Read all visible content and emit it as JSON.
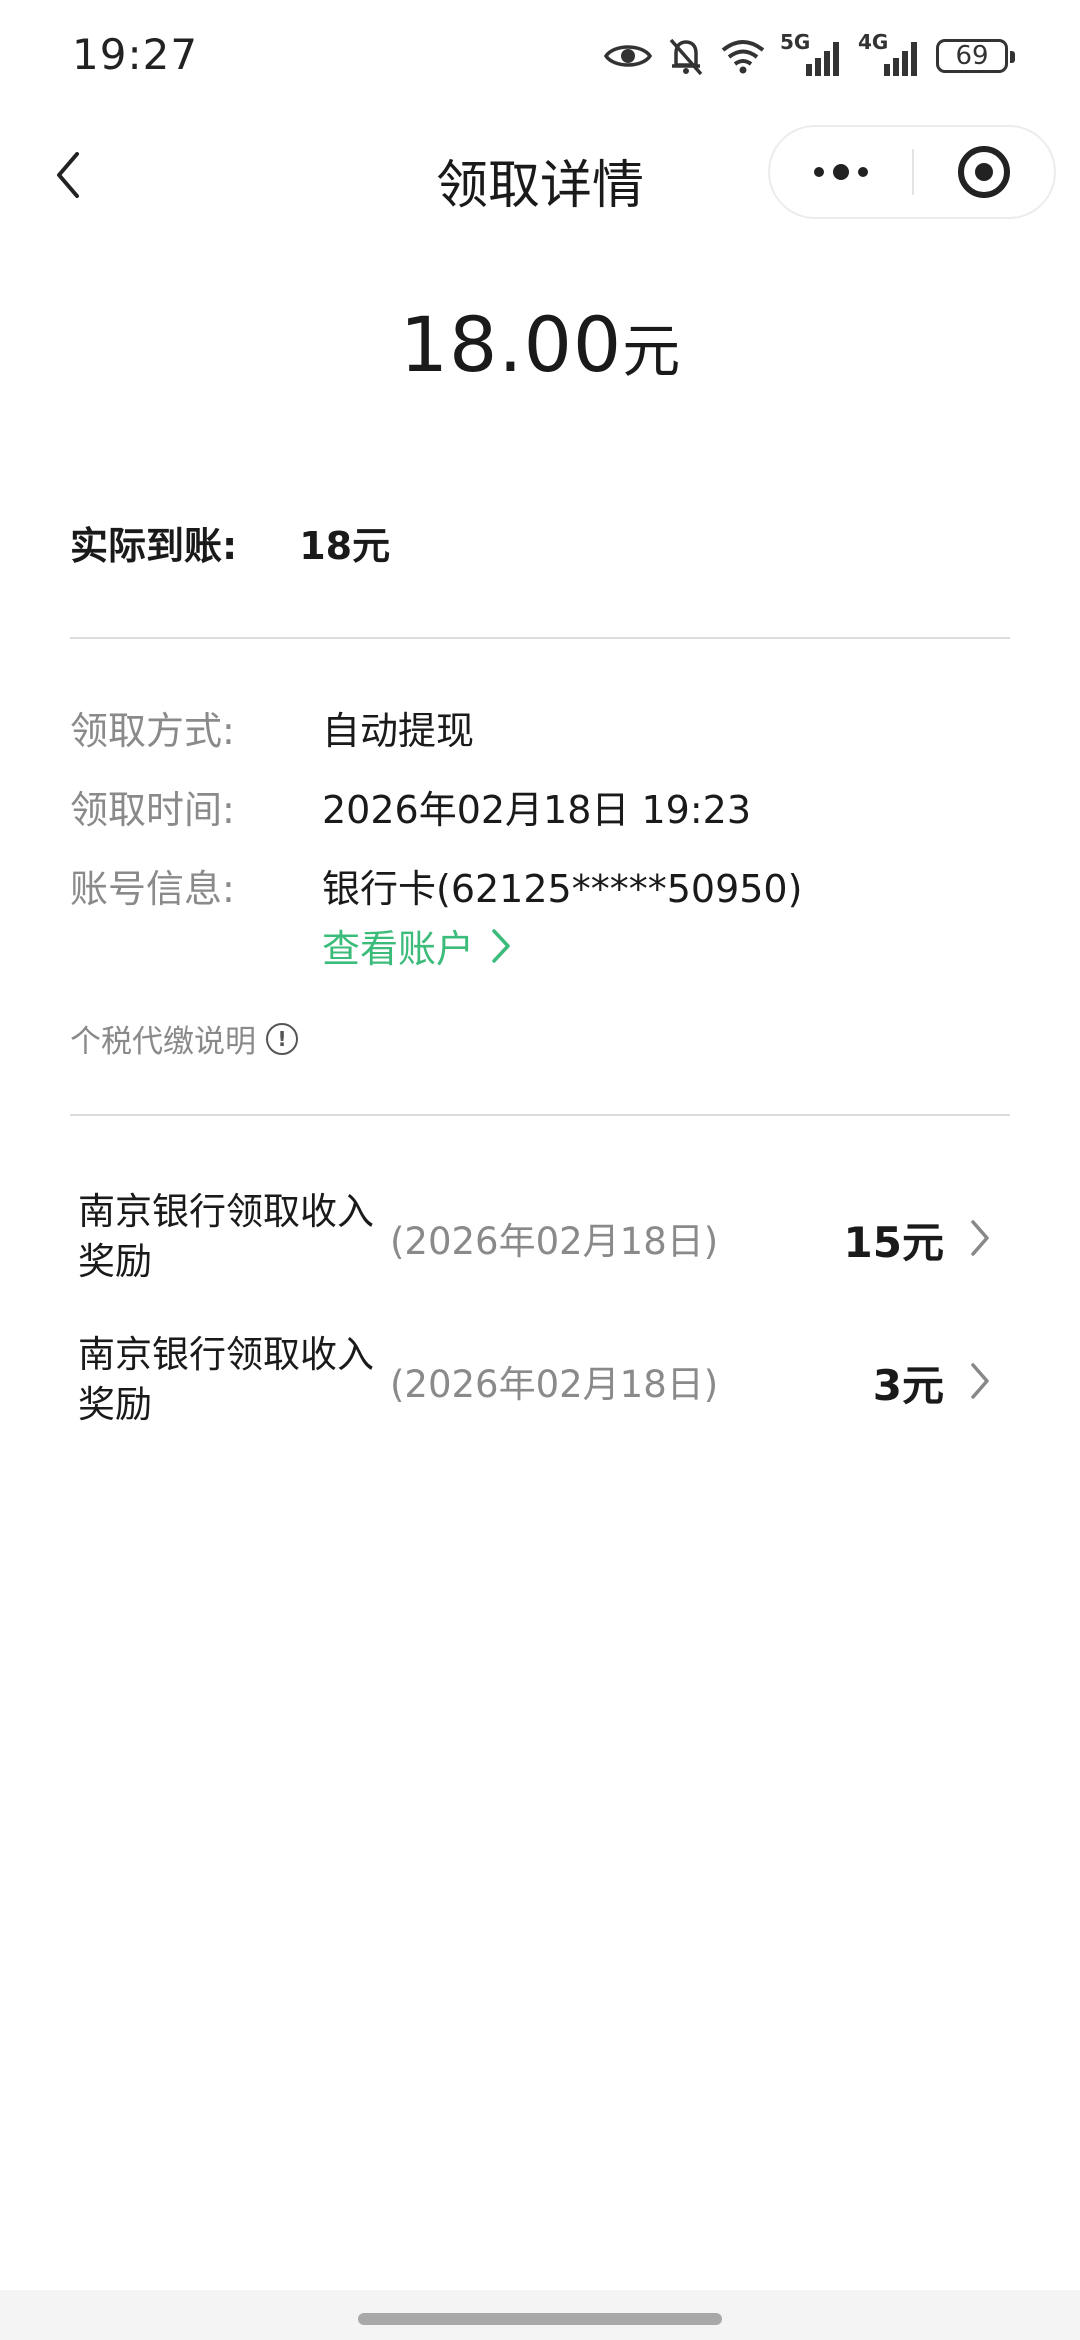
{
  "status_bar": {
    "time": "19:27",
    "signal_5g": "5G",
    "signal_4g": "4G",
    "battery": "69",
    "icons": [
      "eye-icon",
      "bell-off-icon",
      "wifi-icon",
      "signal-5g-icon",
      "signal-4g-icon",
      "battery-icon"
    ]
  },
  "nav": {
    "title": "领取详情",
    "back_icon": "chevron-left-icon",
    "more_icon": "more-dots-icon",
    "close_icon": "target-close-icon"
  },
  "amount": {
    "value": "18.00",
    "unit": "元"
  },
  "actual": {
    "label": "实际到账:",
    "value": "18元"
  },
  "details": {
    "method_label": "领取方式:",
    "method_value": "自动提现",
    "time_label": "领取时间:",
    "time_value": "2026年02月18日 19:23",
    "account_label": "账号信息:",
    "account_value": "银行卡(62125*****50950)",
    "view_account": "查看账户"
  },
  "tax_note": {
    "text": "个税代缴说明",
    "icon": "info-icon"
  },
  "income_items": [
    {
      "title": "南京银行领取收入奖励",
      "date": "(2026年02月18日)",
      "amount": "15元"
    },
    {
      "title": "南京银行领取收入奖励",
      "date": "(2026年02月18日)",
      "amount": "3元"
    }
  ],
  "colors": {
    "accent_green": "#3cbc7a",
    "text_primary": "#1a1a1a",
    "text_secondary": "#8a8a8a",
    "divider": "#dcdcdc"
  }
}
